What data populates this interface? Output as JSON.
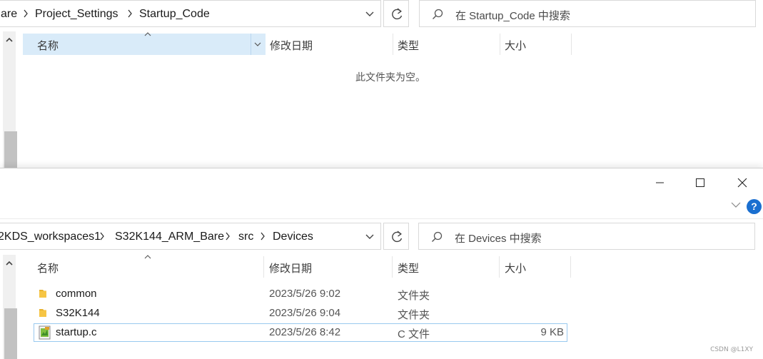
{
  "top_window": {
    "breadcrumb": [
      "are",
      "Project_Settings",
      "Startup_Code"
    ],
    "search_placeholder": "在 Startup_Code 中搜索",
    "columns": [
      "名称",
      "修改日期",
      "类型",
      "大小"
    ],
    "empty_message": "此文件夹为空。"
  },
  "bottom_window": {
    "breadcrumb": [
      "2KDS_workspaces1",
      "S32K144_ARM_Bare",
      "src",
      "Devices"
    ],
    "search_placeholder": "在 Devices 中搜索",
    "columns": [
      "名称",
      "修改日期",
      "类型",
      "大小"
    ],
    "help_label": "?",
    "files": [
      {
        "name": "common",
        "date": "2023/5/26 9:02",
        "type": "文件夹",
        "size": "",
        "icon": "folder-icon"
      },
      {
        "name": "S32K144",
        "date": "2023/5/26 9:04",
        "type": "文件夹",
        "size": "",
        "icon": "folder-icon"
      },
      {
        "name": "startup.c",
        "date": "2023/5/26 8:42",
        "type": "C 文件",
        "size": "9 KB",
        "icon": "c-file-icon",
        "selected": true
      }
    ]
  },
  "watermark": "CSDN @L1XY",
  "colors": {
    "header_highlight": "#d9ebf9",
    "selection_border": "#99c9ef",
    "help_blue": "#1a6fd0",
    "folder": "#f6c544"
  }
}
